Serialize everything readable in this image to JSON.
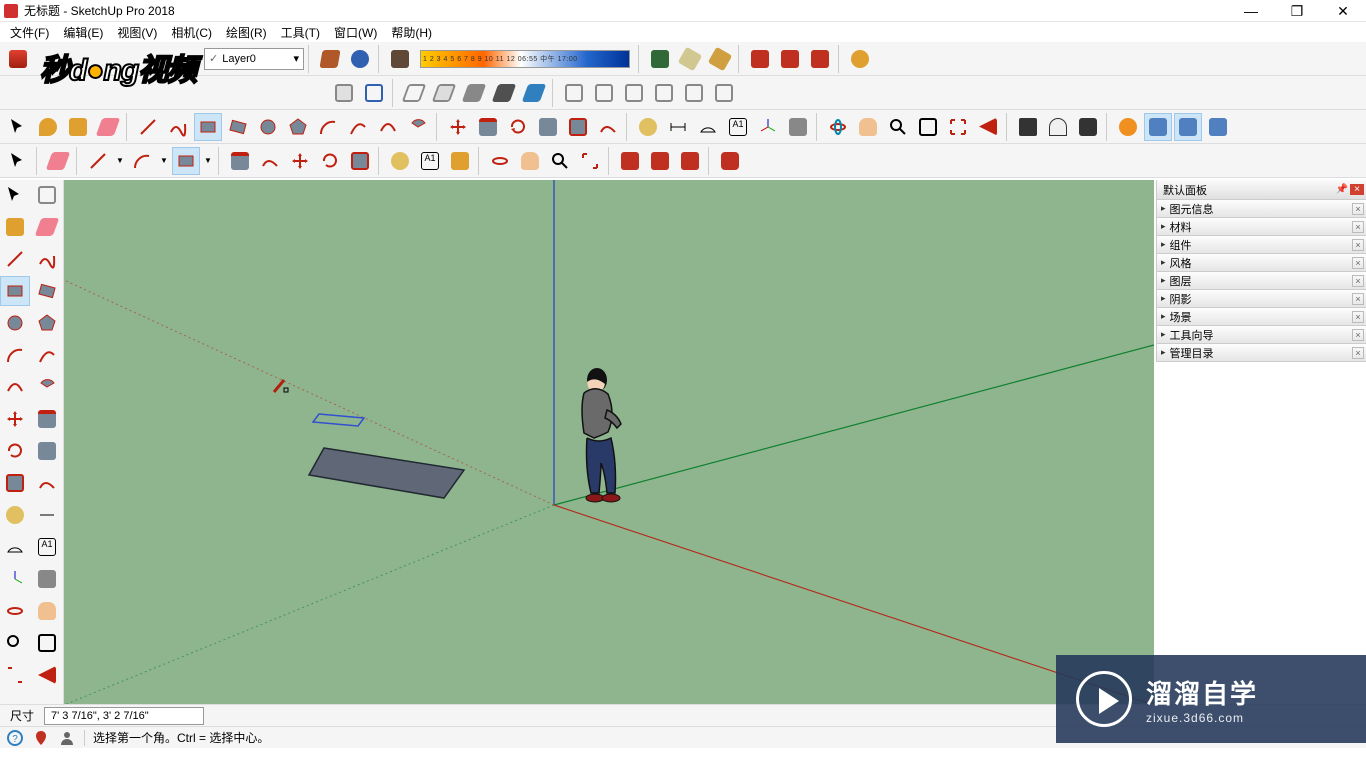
{
  "window": {
    "title": "无标题 - SketchUp Pro 2018",
    "controls": {
      "minimize": "—",
      "maximize": "❐",
      "close": "✕"
    }
  },
  "menu": [
    "文件(F)",
    "编辑(E)",
    "视图(V)",
    "相机(C)",
    "绘图(R)",
    "工具(T)",
    "窗口(W)",
    "帮助(H)"
  ],
  "layer_combo": {
    "value": "Layer0",
    "caret": "▾"
  },
  "shadow_labels": "1 2 3 4 5 6 7 8 9 10 11 12    06:55       中午       17:00",
  "panel": {
    "title": "默认面板",
    "items": [
      "图元信息",
      "材料",
      "组件",
      "风格",
      "图层",
      "阴影",
      "场景",
      "工具向导",
      "管理目录"
    ]
  },
  "dimensions": {
    "label": "尺寸",
    "value": "7' 3 7/16\", 3' 2 7/16\""
  },
  "status": {
    "message": "选择第一个角。Ctrl = 选择中心。"
  },
  "logo_text": {
    "a": "秒",
    "b": "d",
    "c": "ng",
    "d": "视频"
  },
  "brand": {
    "big": "溜溜自学",
    "small": "zixue.3d66.com"
  },
  "colors": {
    "viewport": "#8fb58f",
    "axis_r": "#c03020",
    "axis_g": "#108030",
    "axis_b": "#2030b0"
  }
}
